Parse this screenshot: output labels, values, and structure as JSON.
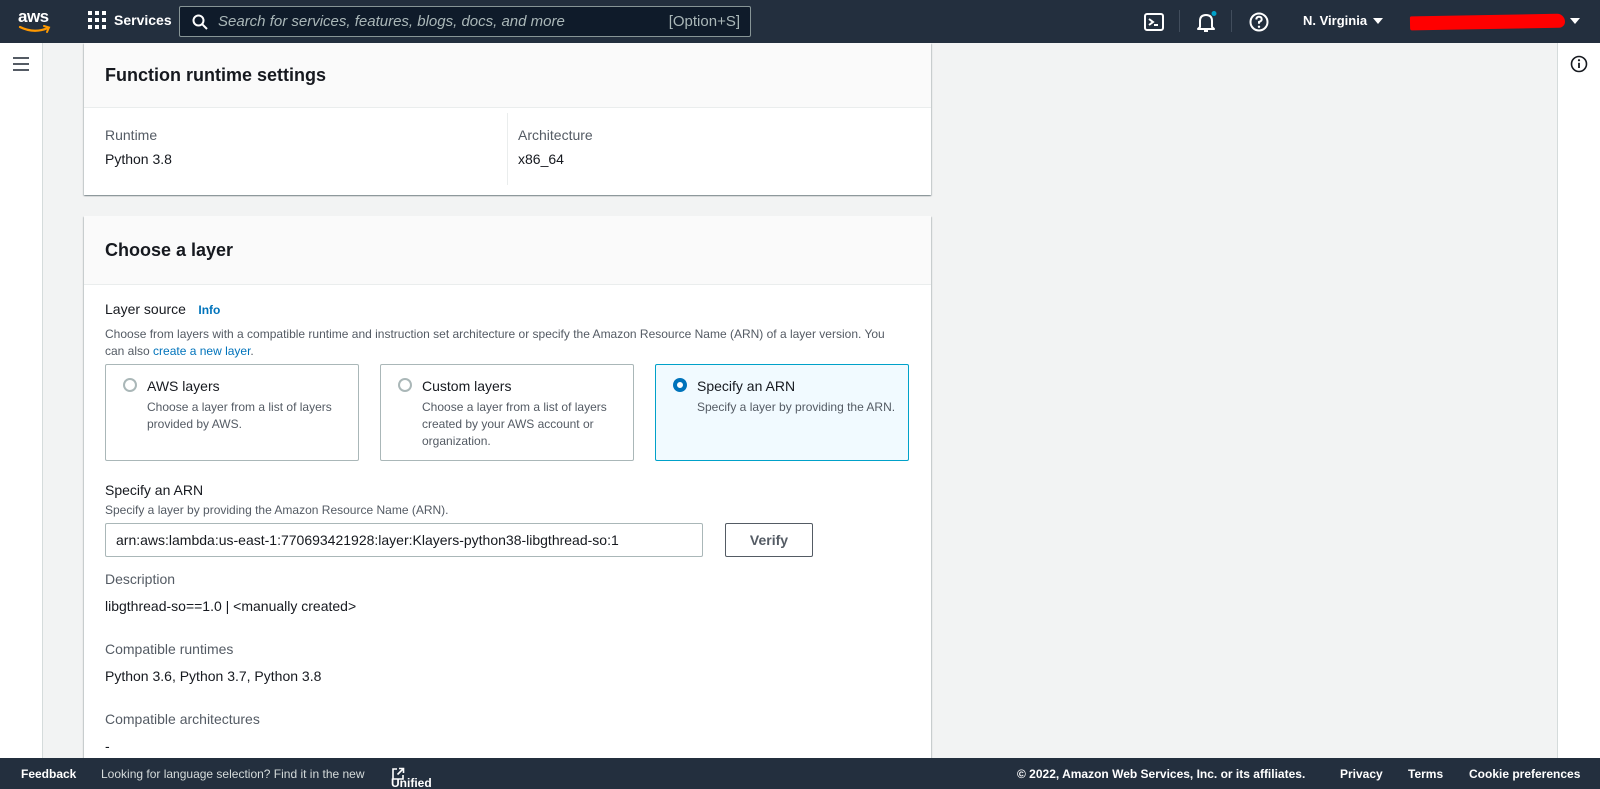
{
  "topnav": {
    "logo_text": "aws",
    "services_label": "Services",
    "search_placeholder": "Search for services, features, blogs, docs, and more",
    "search_shortcut": "[Option+S]",
    "region": "N. Virginia"
  },
  "runtime_settings": {
    "title": "Function runtime settings",
    "runtime_label": "Runtime",
    "runtime_value": "Python 3.8",
    "architecture_label": "Architecture",
    "architecture_value": "x86_64"
  },
  "choose_layer": {
    "title": "Choose a layer",
    "layer_source_label": "Layer source",
    "info_link": "Info",
    "layer_source_desc_pre": "Choose from layers with a compatible runtime and instruction set architecture or specify the Amazon Resource Name (ARN) of a layer version. You can also ",
    "create_layer_link": "create a new layer",
    "layer_source_desc_post": ".",
    "options": [
      {
        "title": "AWS layers",
        "desc": "Choose a layer from a list of layers provided by AWS.",
        "selected": false
      },
      {
        "title": "Custom layers",
        "desc": "Choose a layer from a list of layers created by your AWS account or organization.",
        "selected": false
      },
      {
        "title": "Specify an ARN",
        "desc": "Specify a layer by providing the ARN.",
        "selected": true
      }
    ],
    "arn_label": "Specify an ARN",
    "arn_desc": "Specify a layer by providing the Amazon Resource Name (ARN).",
    "arn_value": "arn:aws:lambda:us-east-1:770693421928:layer:Klayers-python38-libgthread-so:1",
    "verify_label": "Verify",
    "description_label": "Description",
    "description_value": "libgthread-so==1.0 | <manually created>",
    "runtimes_label": "Compatible runtimes",
    "runtimes_value": "Python 3.6, Python 3.7, Python 3.8",
    "architectures_label": "Compatible architectures",
    "architectures_value": "-"
  },
  "footer": {
    "feedback": "Feedback",
    "lang_text": "Looking for language selection? Find it in the new",
    "unified_settings": "Unified Settings",
    "copyright": "© 2022, Amazon Web Services, Inc. or its affiliates.",
    "privacy": "Privacy",
    "terms": "Terms",
    "cookie": "Cookie preferences"
  }
}
